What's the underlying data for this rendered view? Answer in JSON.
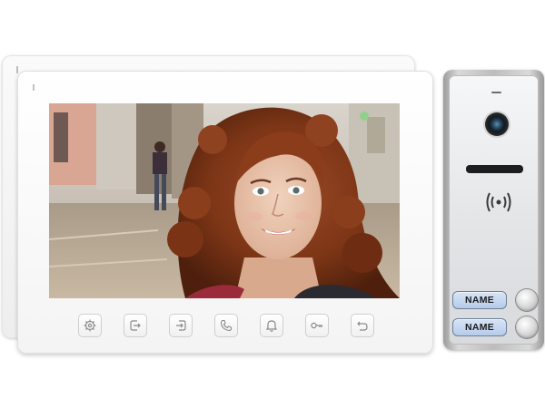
{
  "monitor": {
    "screen_scene": "video-feed",
    "control_buttons": [
      {
        "icon": "settings-icon"
      },
      {
        "icon": "monitor-view-icon"
      },
      {
        "icon": "camera-switch-icon"
      },
      {
        "icon": "phone-handset-icon"
      },
      {
        "icon": "bell-icon"
      },
      {
        "icon": "key-icon"
      },
      {
        "icon": "back-icon"
      }
    ]
  },
  "door_station": {
    "name_plates": [
      "NAME",
      "NAME"
    ],
    "name_plate_color": "#b5cbea",
    "rfid_icon": "rfid-wave-icon"
  }
}
